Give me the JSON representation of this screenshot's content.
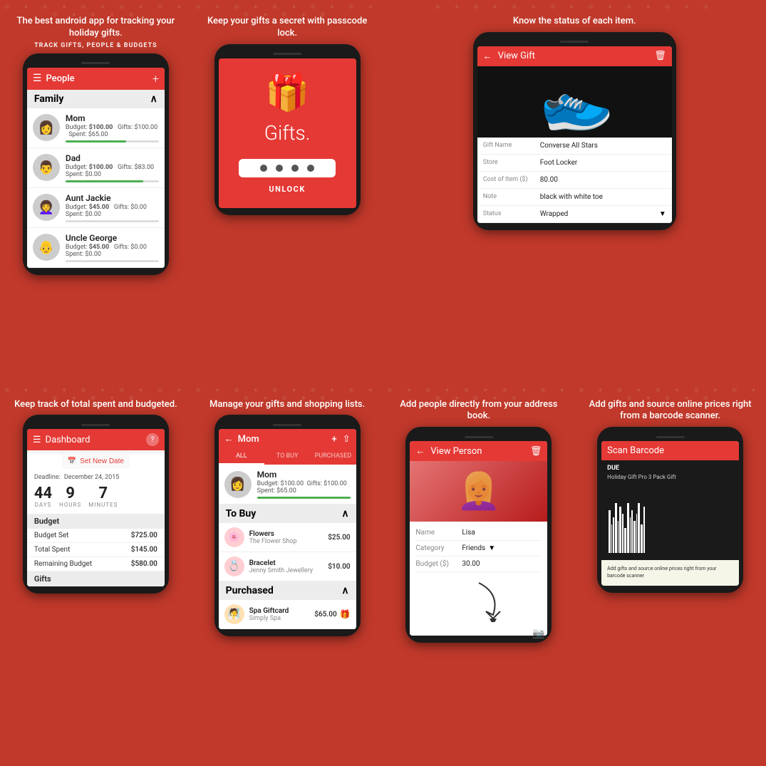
{
  "panels": {
    "p1": {
      "headline": "The best android app for tracking your holiday gifts.",
      "sub": "TRACK GIFTS, PEOPLE & BUDGETS",
      "toolbar": {
        "menu": "☰",
        "title": "People",
        "add": "+"
      },
      "section": "Family",
      "people": [
        {
          "name": "Mom",
          "budget": "$100.00",
          "gifts": "$100.00",
          "spent": "$65.00",
          "pct": 65,
          "emoji": "👩"
        },
        {
          "name": "Dad",
          "budget": "$100.00",
          "gifts": "$83.00",
          "spent": "$0.00",
          "pct": 83,
          "emoji": "👨"
        },
        {
          "name": "Aunt Jackie",
          "budget": "$45.00",
          "gifts": "$0.00",
          "spent": "$0.00",
          "pct": 0,
          "emoji": "👩‍🦱"
        },
        {
          "name": "Uncle George",
          "budget": "$45.00",
          "gifts": "$0.00",
          "spent": "$0.00",
          "pct": 0,
          "emoji": "👴"
        }
      ]
    },
    "p2": {
      "headline": "Keep your gifts a secret with passcode lock.",
      "gift_icon": "🎁",
      "gifts_label": "Gifts.",
      "dots": 4,
      "unlock": "UNLOCK"
    },
    "p3": {
      "headline": "Know the status of each item.",
      "toolbar": {
        "back": "←",
        "title": "View Gift",
        "delete": "🗑"
      },
      "fields": [
        {
          "label": "Gift Name",
          "value": "Converse All Stars"
        },
        {
          "label": "Store",
          "value": "Foot Locker"
        },
        {
          "label": "Cost of Item ($)",
          "value": "80.00"
        },
        {
          "label": "Note",
          "value": "black with white toe"
        },
        {
          "label": "Status",
          "value": "Wrapped"
        }
      ]
    },
    "p5": {
      "headline": "Keep track of total spent and budgeted.",
      "toolbar": {
        "menu": "☰",
        "title": "Dashboard",
        "help": "?"
      },
      "date_btn": "Set New Date",
      "deadline_label": "Deadline:",
      "deadline_value": "December 24, 2015",
      "countdown": {
        "days": 44,
        "hours": 9,
        "minutes": 7
      },
      "budget_section": "Budget",
      "budget_rows": [
        {
          "label": "Budget Set",
          "value": "$725.00"
        },
        {
          "label": "Total Spent",
          "value": "$145.00"
        },
        {
          "label": "Remaining Budget",
          "value": "$580.00"
        }
      ],
      "gifts_section": "Gifts"
    },
    "p6": {
      "headline": "Manage your gifts and shopping lists.",
      "toolbar": {
        "back": "←",
        "title": "Mom",
        "add": "+",
        "share": "⇧"
      },
      "tabs": [
        "ALL",
        "TO BUY",
        "PURCHASED"
      ],
      "person": {
        "name": "Mom",
        "budget": "$100.00",
        "gifts": "$100.00",
        "spent": "$65.00"
      },
      "to_buy": {
        "label": "To Buy",
        "items": [
          {
            "name": "Flowers",
            "store": "The Flower Shop",
            "price": "$25.00",
            "emoji": "🌸"
          },
          {
            "name": "Bracelet",
            "store": "Jenny Smith Jewellery",
            "price": "$10.00",
            "emoji": "💍"
          }
        ]
      },
      "purchased": {
        "label": "Purchased",
        "items": [
          {
            "name": "Spa Giftcard",
            "store": "Simply Spa",
            "price": "$65.00",
            "emoji": "🧖"
          }
        ]
      }
    },
    "p7": {
      "headline": "Add people directly from your address book.",
      "toolbar": {
        "back": "←",
        "title": "View Person",
        "delete": "🗑"
      },
      "fields": [
        {
          "label": "Name",
          "value": "Lisa"
        },
        {
          "label": "Category",
          "value": "Friends"
        },
        {
          "label": "Budget ($)",
          "value": "30.00"
        }
      ]
    },
    "p8": {
      "headline": "Add gifts and source online prices right from a barcode scanner.",
      "toolbar": {
        "title": "Scan Barcode"
      },
      "barcode_label": "Add gifts and source online prices right from your barcode scanner",
      "product_text": "Holiday Gift Pro 3 Pack Gift"
    }
  }
}
